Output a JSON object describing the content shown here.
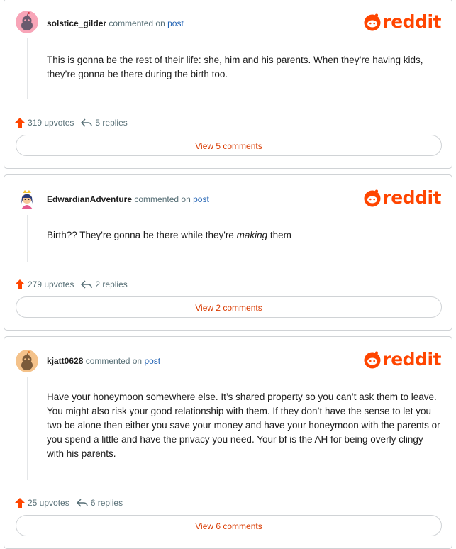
{
  "brand": {
    "wordmark": "reddit",
    "accent": "#ff4500"
  },
  "comments": [
    {
      "username": "solstice_gilder",
      "verb": "commented on",
      "post_link": "post",
      "body": "This is gonna be the rest of their life: she, him and his parents. When they’re having kids, they’re gonna be there during the birth too.",
      "upvotes": "319 upvotes",
      "replies": "5 replies",
      "view_label": "View 5 comments",
      "avatar": "snoo-pink-avatar"
    },
    {
      "username": "EdwardianAdventure",
      "verb": "commented on",
      "post_link": "post",
      "body_plain": "Birth?? They're gonna be there while they're ",
      "body_em": "making",
      "body_tail": " them",
      "upvotes": "279 upvotes",
      "replies": "2 replies",
      "view_label": "View 2 comments",
      "avatar": "custom-snoo-avatar"
    },
    {
      "username": "kjatt0628",
      "verb": "commented on",
      "post_link": "post",
      "body": "Have your honeymoon somewhere else. It’s shared property so you can’t ask them to leave. You might also risk your good relationship with them. If they don’t have the sense to let you two be alone then either you save your money and have your honeymoon with the parents or you spend a little and have the privacy you need. Your bf is the AH for being overly clingy with his parents.",
      "upvotes": "25 upvotes",
      "replies": "6 replies",
      "view_label": "View 6 comments",
      "avatar": "snoo-orange-avatar"
    }
  ]
}
